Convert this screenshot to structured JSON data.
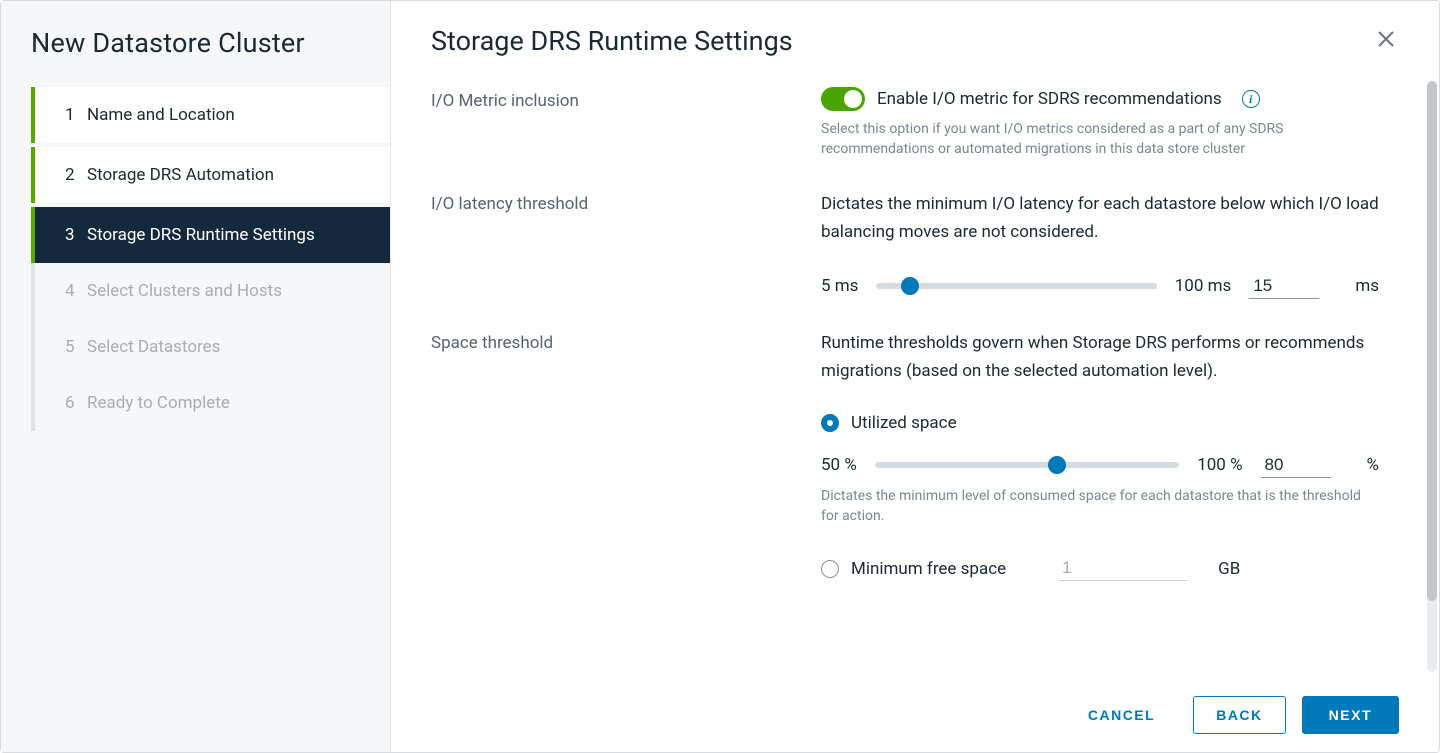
{
  "sidebar": {
    "title": "New Datastore Cluster",
    "steps": [
      {
        "num": "1",
        "label": "Name and Location",
        "state": "completed"
      },
      {
        "num": "2",
        "label": "Storage DRS Automation",
        "state": "completed"
      },
      {
        "num": "3",
        "label": "Storage DRS Runtime Settings",
        "state": "active"
      },
      {
        "num": "4",
        "label": "Select Clusters and Hosts",
        "state": "disabled"
      },
      {
        "num": "5",
        "label": "Select Datastores",
        "state": "disabled"
      },
      {
        "num": "6",
        "label": "Ready to Complete",
        "state": "disabled"
      }
    ]
  },
  "main": {
    "title": "Storage DRS Runtime Settings",
    "io_metric": {
      "label": "I/O Metric inclusion",
      "toggle_label": "Enable I/O metric for SDRS recommendations",
      "enabled": true,
      "help": "Select this option if you want I/O metrics considered as a part of any SDRS recommendations or automated migrations in this data store cluster"
    },
    "latency": {
      "label": "I/O latency threshold",
      "description": "Dictates the minimum I/O latency for each datastore below which I/O load balancing moves are not considered.",
      "min_label": "5 ms",
      "max_label": "100 ms",
      "value": "15",
      "unit": "ms",
      "slider_percent": 12
    },
    "space": {
      "label": "Space threshold",
      "description": "Runtime thresholds govern when Storage DRS performs or recommends migrations (based on the selected automation level).",
      "utilized": {
        "label": "Utilized space",
        "selected": true,
        "min_label": "50 %",
        "max_label": "100 %",
        "value": "80",
        "unit": "%",
        "slider_percent": 60,
        "help": "Dictates the minimum level of consumed space for each datastore that is the threshold for action."
      },
      "min_free": {
        "label": "Minimum free space",
        "selected": false,
        "value": "1",
        "unit": "GB"
      }
    }
  },
  "footer": {
    "cancel": "CANCEL",
    "back": "BACK",
    "next": "NEXT"
  }
}
